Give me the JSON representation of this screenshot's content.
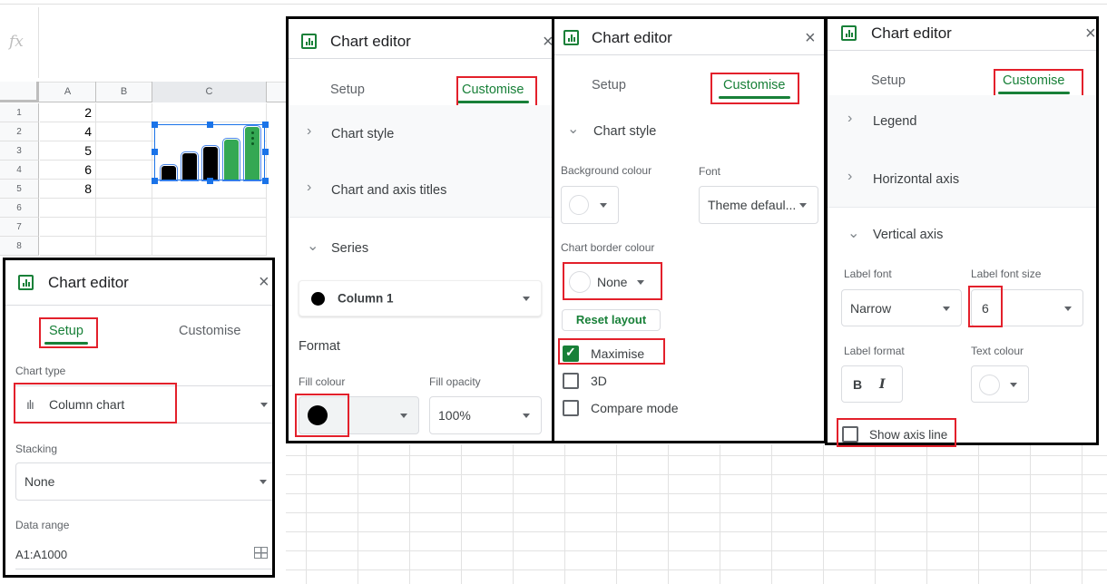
{
  "spreadsheet": {
    "fx_label": "fx",
    "columns": [
      "A",
      "B",
      "C"
    ],
    "rows": [
      "1",
      "2",
      "3",
      "4",
      "5",
      "6",
      "7",
      "8"
    ],
    "column_a_values": [
      "2",
      "4",
      "5",
      "6",
      "8",
      "",
      "",
      ""
    ],
    "mini_chart": {
      "values": [
        2,
        4,
        5,
        6,
        8
      ],
      "bar_colors": [
        "#000000",
        "#000000",
        "#000000",
        "#34a853",
        "#34a853"
      ]
    }
  },
  "panel_setup": {
    "title": "Chart editor",
    "close": "×",
    "tabs": [
      "Setup",
      "Customise"
    ],
    "active_tab": "Setup",
    "chart_type_label": "Chart type",
    "chart_type_value": "Column chart",
    "stacking_label": "Stacking",
    "stacking_value": "None",
    "data_range_label": "Data range",
    "data_range_value": "A1:A1000"
  },
  "panel_series": {
    "title": "Chart editor",
    "close": "×",
    "tabs": [
      "Setup",
      "Customise"
    ],
    "active_tab": "Customise",
    "sections": [
      "Chart style",
      "Chart and axis titles",
      "Series"
    ],
    "series_value": "Column 1",
    "format_heading": "Format",
    "fill_colour_label": "Fill colour",
    "fill_colour": "#000000",
    "fill_opacity_label": "Fill opacity",
    "fill_opacity_value": "100%"
  },
  "panel_style": {
    "title": "Chart editor",
    "close": "×",
    "tabs": [
      "Setup",
      "Customise"
    ],
    "active_tab": "Customise",
    "section": "Chart style",
    "background_colour_label": "Background colour",
    "font_label": "Font",
    "font_value": "Theme defaul...",
    "border_colour_label": "Chart border colour",
    "border_colour_value": "None",
    "reset_layout": "Reset layout",
    "checkboxes": [
      {
        "label": "Maximise",
        "checked": true
      },
      {
        "label": "3D",
        "checked": false
      },
      {
        "label": "Compare mode",
        "checked": false
      }
    ]
  },
  "panel_axis": {
    "title": "Chart editor",
    "close": "×",
    "tabs": [
      "Setup",
      "Customise"
    ],
    "active_tab": "Customise",
    "sections": [
      "Legend",
      "Horizontal axis",
      "Vertical axis"
    ],
    "label_font_label": "Label font",
    "label_font_value": "Narrow",
    "label_font_size_label": "Label font size",
    "label_font_size_value": "6",
    "label_format_label": "Label format",
    "bold": "B",
    "italic": "I",
    "text_colour_label": "Text colour",
    "show_axis_line_label": "Show axis line",
    "show_axis_line_checked": false
  },
  "colors": {
    "accent_green": "#188038",
    "highlight_red": "#e3202b",
    "selection_blue": "#1a73e8"
  }
}
